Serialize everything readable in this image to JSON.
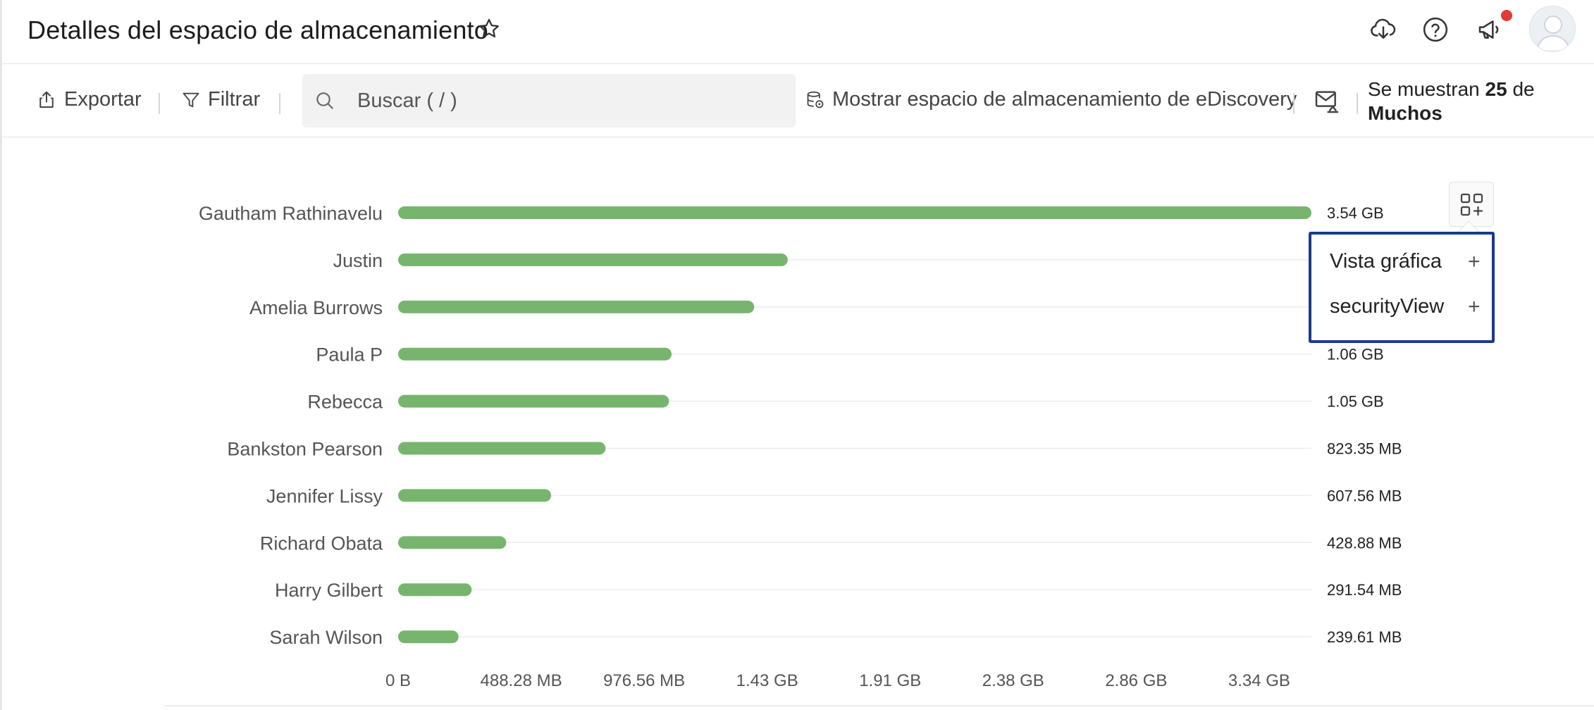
{
  "header": {
    "title": "Detalles del espacio de almacenamiento",
    "icons": [
      "star-icon",
      "cloud-download-icon",
      "help-icon",
      "announcement-icon",
      "avatar"
    ],
    "notification_color": "#e53935"
  },
  "toolbar": {
    "export_label": "Exportar",
    "filter_label": "Filtrar",
    "search_placeholder": "Buscar ( / )",
    "ediscovery_label": "Mostrar espacio de almacenamiento de eDiscovery",
    "count_prefix": "Se muestran",
    "count_value": "25",
    "count_mid": "de",
    "count_total": "Muchos"
  },
  "chart_menu": {
    "items": [
      {
        "label": "Vista gráfica"
      },
      {
        "label": "securityView"
      }
    ]
  },
  "chart_data": {
    "type": "bar",
    "orientation": "horizontal",
    "bar_color": "#77b56f",
    "categories": [
      "Gautham Rathinavelu",
      "Justin",
      "Amelia Burrows",
      "Paula P",
      "Rebecca",
      "Bankston Pearson",
      "Jennifer Lissy",
      "Richard Obata",
      "Harry Gilbert",
      "Sarah Wilson"
    ],
    "values_gb": [
      3.54,
      1.51,
      1.38,
      1.06,
      1.05,
      0.804,
      0.593,
      0.419,
      0.285,
      0.234
    ],
    "value_labels": [
      "3.54 GB",
      "",
      "",
      "1.06 GB",
      "1.05 GB",
      "823.35 MB",
      "607.56 MB",
      "428.88 MB",
      "291.54 MB",
      "239.61 MB"
    ],
    "x_ticks": [
      "0 B",
      "488.28 MB",
      "976.56 MB",
      "1.43 GB",
      "1.91 GB",
      "2.38 GB",
      "2.86 GB",
      "3.34 GB"
    ],
    "xlim_gb": [
      0,
      3.54
    ],
    "tick_step_gb": 0.4768,
    "grid": "horizontal"
  }
}
